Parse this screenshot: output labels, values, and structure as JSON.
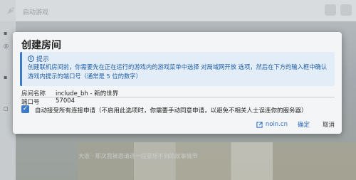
{
  "app": {
    "title": "启动游戏"
  },
  "background": {
    "footer_text": "大连 · 那次我被邀请进一段意想不到的故事情节"
  },
  "dialog": {
    "title": "创建房间",
    "hint": {
      "heading": "提示",
      "text": "创建联机房间前，你需要先在正在运行的游戏内的游戏菜单中选择 对局域网开放 选项，然后在下方的输入框中确认游戏内提示的端口号（通常是 5 位的数字）"
    },
    "room_name": {
      "label": "房间名称",
      "value": "include_bh - 新的世界"
    },
    "port": {
      "label": "端口号",
      "value": "57004"
    },
    "auto_accept": {
      "checked": true,
      "label": "自动接受所有连接申请（不启用此选项时，你需要手动同意申请，以避免不相关人士误连你的服务器）"
    },
    "buttons": {
      "link": "noin.cn",
      "ok": "确定",
      "cancel": "取消"
    }
  },
  "colors": {
    "accent": "#3f7ac6",
    "hint_bg": "#e3edf8"
  }
}
